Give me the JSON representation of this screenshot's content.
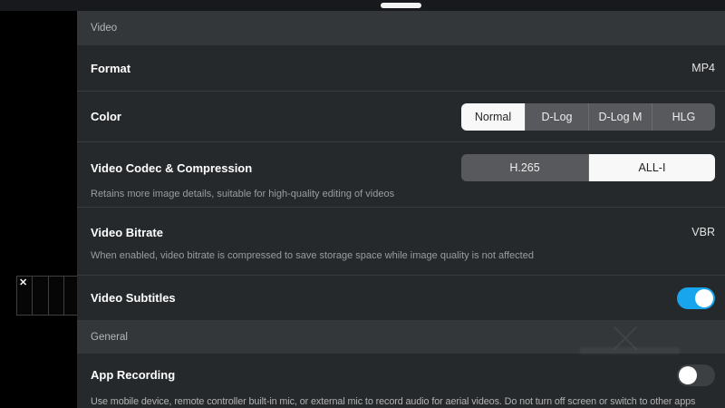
{
  "icons": {
    "close": "✕"
  },
  "colors": {
    "accent_blue": "#19a5ee",
    "panel_bg": "#26292b",
    "section_header_bg": "#33373a",
    "segment_bg": "#58595c",
    "segment_selected_bg": "#f8f8f8",
    "toggle_off_bg": "#3c4043"
  },
  "panel": {
    "video": {
      "header": "Video",
      "format": {
        "label": "Format",
        "value": "MP4"
      },
      "color": {
        "label": "Color",
        "options": [
          "Normal",
          "D-Log",
          "D-Log M",
          "HLG"
        ],
        "selected": "Normal"
      },
      "codec": {
        "label": "Video Codec & Compression",
        "options": [
          "H.265",
          "ALL-I"
        ],
        "selected": "ALL-I",
        "description": "Retains more image details, suitable for high-quality editing of videos"
      },
      "bitrate": {
        "label": "Video Bitrate",
        "value": "VBR",
        "description": "When enabled, video bitrate is compressed to save storage space while image quality is not affected"
      },
      "subtitles": {
        "label": "Video Subtitles",
        "enabled": true
      }
    },
    "general": {
      "header": "General",
      "app_recording": {
        "label": "App Recording",
        "enabled": false,
        "description": "Use mobile device, remote controller built-in mic, or external mic to record audio for aerial videos. Do not turn off screen or switch to other apps"
      }
    }
  }
}
